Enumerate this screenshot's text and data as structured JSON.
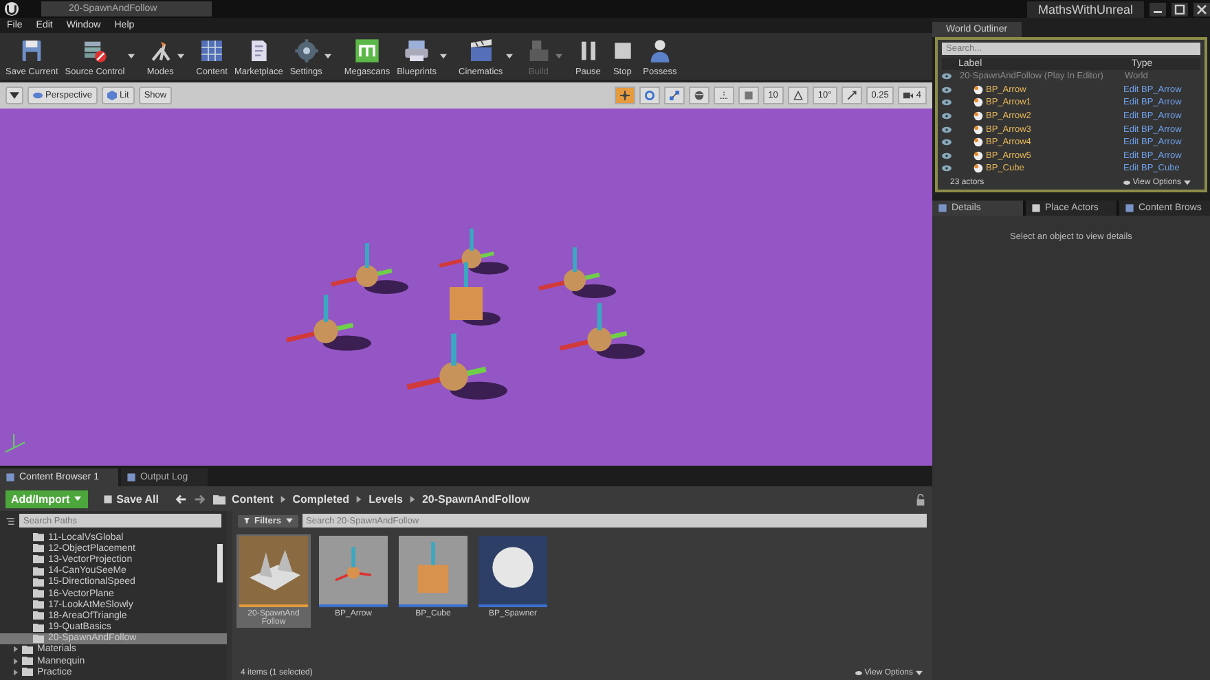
{
  "window": {
    "tab": "20-SpawnAndFollow",
    "project": "MathsWithUnreal"
  },
  "menu": [
    "File",
    "Edit",
    "Window",
    "Help"
  ],
  "toolbar": [
    {
      "kind": "save",
      "label": "Save Current",
      "dropdown": false,
      "disabled": false
    },
    {
      "kind": "source-control",
      "label": "Source Control",
      "dropdown": true,
      "disabled": false
    },
    {
      "kind": "modes",
      "label": "Modes",
      "dropdown": true,
      "disabled": false
    },
    {
      "kind": "content",
      "label": "Content",
      "dropdown": false,
      "disabled": false
    },
    {
      "kind": "marketplace",
      "label": "Marketplace",
      "dropdown": false,
      "disabled": false
    },
    {
      "kind": "settings",
      "label": "Settings",
      "dropdown": true,
      "disabled": false
    },
    {
      "kind": "megascans",
      "label": "Megascans",
      "dropdown": false,
      "disabled": false
    },
    {
      "kind": "blueprints",
      "label": "Blueprints",
      "dropdown": true,
      "disabled": false
    },
    {
      "kind": "cinematics",
      "label": "Cinematics",
      "dropdown": true,
      "disabled": false
    },
    {
      "kind": "build",
      "label": "Build",
      "dropdown": true,
      "disabled": true
    },
    {
      "kind": "pause",
      "label": "Pause",
      "dropdown": false,
      "disabled": false
    },
    {
      "kind": "stop",
      "label": "Stop",
      "dropdown": false,
      "disabled": false
    },
    {
      "kind": "possess",
      "label": "Possess",
      "dropdown": false,
      "disabled": false
    }
  ],
  "viewport": {
    "buttons": [
      {
        "kind": "menu"
      },
      {
        "kind": "perspective",
        "label": "Perspective"
      },
      {
        "kind": "lit",
        "label": "Lit"
      },
      {
        "kind": "plain",
        "label": "Show"
      }
    ],
    "tools": [
      {
        "kind": "move",
        "selected": true
      },
      {
        "kind": "rotate",
        "selected": false
      },
      {
        "kind": "scale",
        "selected": false
      },
      {
        "kind": "world",
        "selected": false
      },
      {
        "kind": "surface",
        "selected": false
      },
      {
        "kind": "grid",
        "selected": false
      },
      {
        "kind": "value",
        "value": "10",
        "selected": false
      },
      {
        "kind": "angle",
        "selected": false
      },
      {
        "kind": "value",
        "value": "10°",
        "selected": false
      },
      {
        "kind": "scale-snap",
        "selected": false
      },
      {
        "kind": "value",
        "value": "0.25",
        "selected": false
      },
      {
        "kind": "camera",
        "value": "4",
        "selected": false
      }
    ]
  },
  "bottom_tabs": [
    {
      "label": "Content Browser 1",
      "selected": true
    },
    {
      "label": "Output Log",
      "selected": false
    }
  ],
  "content_browser": {
    "add_button": "Add/Import",
    "save_all": "Save All",
    "path": [
      "Content",
      "Completed",
      "Levels",
      "20-SpawnAndFollow"
    ],
    "path_search": {
      "placeholder": "Search Paths"
    },
    "tree": [
      {
        "label": "11-LocalVsGlobal",
        "selected": false
      },
      {
        "label": "12-ObjectPlacement",
        "selected": false
      },
      {
        "label": "13-VectorProjection",
        "selected": false
      },
      {
        "label": "14-CanYouSeeMe",
        "selected": false
      },
      {
        "label": "15-DirectionalSpeed",
        "selected": false
      },
      {
        "label": "16-VectorPlane",
        "selected": false
      },
      {
        "label": "17-LookAtMeSlowly",
        "selected": false
      },
      {
        "label": "18-AreaOfTriangle",
        "selected": false
      },
      {
        "label": "19-QuatBasics",
        "selected": false
      },
      {
        "label": "20-SpawnAndFollow",
        "selected": true
      }
    ],
    "top_folders": [
      {
        "label": "Materials",
        "expanded": false
      },
      {
        "label": "Mannequin",
        "expanded": false
      },
      {
        "label": "Practice",
        "expanded": false
      }
    ],
    "filters": "Filters",
    "asset_search": {
      "placeholder": "Search 20-SpawnAndFollow"
    },
    "assets": [
      {
        "kind": "level",
        "name": "20-SpawnAnd Follow",
        "selected": true
      },
      {
        "kind": "arrow",
        "name": "BP_Arrow",
        "selected": false
      },
      {
        "kind": "cube",
        "name": "BP_Cube",
        "selected": false
      },
      {
        "kind": "sphere",
        "name": "BP_Spawner",
        "selected": false
      }
    ],
    "status": "4 items (1 selected)",
    "view_options": "View Options"
  },
  "world_outliner": {
    "tab": "World Outliner",
    "search": {
      "placeholder": "Search..."
    },
    "columns": [
      "Label",
      "Type"
    ],
    "rows": [
      {
        "label": "20-SpawnAndFollow (Play In Editor)",
        "type": "World",
        "children": [
          {
            "label": "BP_Arrow",
            "type": "Edit BP_Arrow"
          },
          {
            "label": "BP_Arrow1",
            "type": "Edit BP_Arrow"
          },
          {
            "label": "BP_Arrow2",
            "type": "Edit BP_Arrow"
          },
          {
            "label": "BP_Arrow3",
            "type": "Edit BP_Arrow"
          },
          {
            "label": "BP_Arrow4",
            "type": "Edit BP_Arrow"
          },
          {
            "label": "BP_Arrow5",
            "type": "Edit BP_Arrow"
          },
          {
            "label": "BP_Cube",
            "type": "Edit BP_Cube"
          }
        ]
      }
    ],
    "count": "23 actors",
    "view_options": "View Options"
  },
  "details_tabs": [
    {
      "kind": "details",
      "label": "Details",
      "selected": true
    },
    {
      "kind": "place",
      "label": "Place Actors",
      "selected": false
    },
    {
      "kind": "browser",
      "label": "Content Brows",
      "selected": false
    }
  ],
  "details_hint": "Select an object to view details"
}
